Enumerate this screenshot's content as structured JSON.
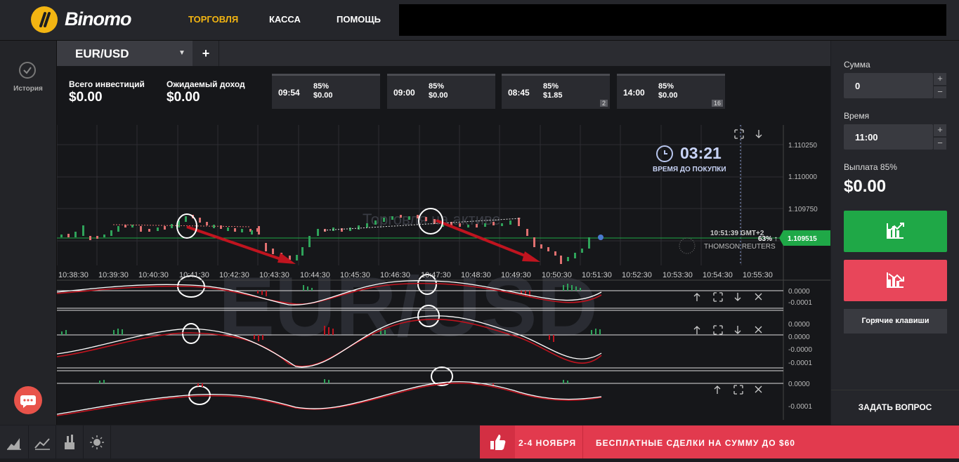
{
  "brand": {
    "name": "Binomo",
    "logo_glyph": "//"
  },
  "nav": [
    {
      "label": "ТОРГОВЛЯ",
      "active": true
    },
    {
      "label": "КАССА",
      "active": false
    },
    {
      "label": "ПОМОЩЬ",
      "active": false
    }
  ],
  "sidebar": {
    "history_label": "История"
  },
  "tabs": {
    "asset": "EUR/USD",
    "add": "+"
  },
  "investments": {
    "total_label": "Всего инвестиций",
    "total_value": "$0.00",
    "expected_label": "Ожидаемый доход",
    "expected_value": "$0.00"
  },
  "deals": [
    {
      "time": "09:54",
      "percent": "85%",
      "amount": "$0.00",
      "badge": ""
    },
    {
      "time": "09:00",
      "percent": "85%",
      "amount": "$0.00",
      "badge": ""
    },
    {
      "time": "08:45",
      "percent": "85%",
      "amount": "$1.85",
      "badge": "2"
    },
    {
      "time": "14:00",
      "percent": "85%",
      "amount": "$0.00",
      "badge": "16"
    }
  ],
  "timer": {
    "value": "03:21",
    "label": "ВРЕМЯ ДО ПОКУПКИ"
  },
  "chart": {
    "watermark": "EUR/USD",
    "overlay_text": "Торговля на активе",
    "current_time": "10:51:39 GMT+2",
    "current_percent": "63% ↑",
    "current_price": "1.109515",
    "provider": "THOMSON REUTERS",
    "price_ticks": [
      "1.110250",
      "1.110000",
      "1.109750"
    ],
    "time_ticks": [
      "10:38:30",
      "10:39:30",
      "10:40:30",
      "10:41:30",
      "10:42:30",
      "10:43:30",
      "10:44:30",
      "10:45:30",
      "10:46:30",
      "10:47:30",
      "10:48:30",
      "10:49:30",
      "10:50:30",
      "10:51:30",
      "10:52:30",
      "10:53:30",
      "10:54:30",
      "10:55:30"
    ],
    "ind1_ticks": [
      "0.0000",
      "-0.0001"
    ],
    "ind2_ticks": [
      "0.0000",
      "0.0000",
      "-0.0000",
      "-0.0001"
    ],
    "ind3_ticks": [
      "0.0000",
      "-0.0001"
    ]
  },
  "panel": {
    "amount_label": "Сумма",
    "amount_value": "0",
    "time_label": "Время",
    "time_value": "11:00",
    "payout_label": "Выплата 85%",
    "payout_value": "$0.00",
    "hotkeys": "Горячие клавиши",
    "ask": "ЗАДАТЬ ВОПРОС",
    "plus": "+",
    "minus": "−"
  },
  "promo": {
    "dates": "2-4 НОЯБРЯ",
    "text": "БЕСПЛАТНЫЕ СДЕЛКИ НА СУММУ ДО $60"
  },
  "colors": {
    "accent": "#f3b512",
    "up": "#1fa847",
    "down": "#e8465a",
    "promo": "#e23a4e"
  }
}
